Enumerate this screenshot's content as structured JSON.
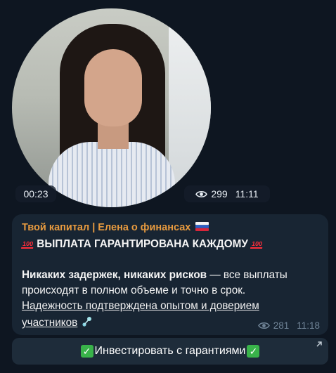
{
  "video": {
    "duration": "00:23",
    "views": "299",
    "time": "11:11"
  },
  "post": {
    "channel_name": "Твой капитал | Елена о финансах",
    "channel_flag_icon": "russia-flag-icon",
    "headline": "ВЫПЛАТА ГАРАНТИРОВАНА КАЖДОМУ",
    "headline_icon": "hundred-points-icon",
    "hundred_label": "100",
    "body_bold": "Никаких задержек, никаких рисков",
    "body_line1_rest": " — все выплаты",
    "body_line2": "происходят в полном объеме и точно в срок.",
    "link_line1": "Надежность подтверждена опытом и доверием",
    "link_line2": "участников",
    "views": "281",
    "time": "11:18"
  },
  "inline_button": {
    "label": "Инвестировать с гарантиями",
    "check_glyph": "✓"
  },
  "colors": {
    "background": "#0e1621",
    "bubble": "#182533",
    "channel_name": "#e79a3f",
    "meta": "#6f8396",
    "check": "#39b34a"
  }
}
